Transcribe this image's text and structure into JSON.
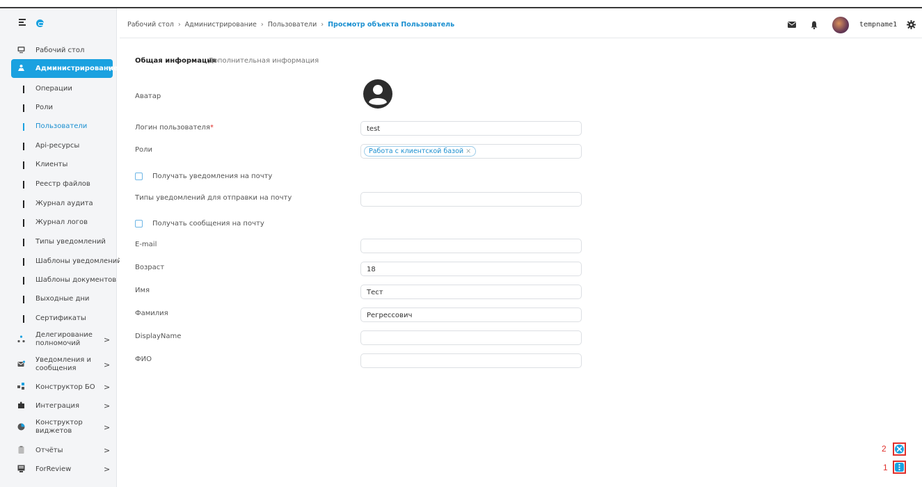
{
  "header": {
    "breadcrumbs": [
      "Рабочий стол",
      "Администрирование",
      "Пользователи"
    ],
    "breadcrumb_current": "Просмотр объекта Пользователь",
    "separator": "›",
    "username": "tempname1"
  },
  "sidebar": {
    "top_items": [
      {
        "label": "Рабочий стол",
        "icon": "monitor-icon"
      },
      {
        "label": "Администрирование",
        "icon": "admin-icon",
        "chevron": "∨"
      }
    ],
    "sub_items": [
      {
        "label": "Операции"
      },
      {
        "label": "Роли"
      },
      {
        "label": "Пользователи"
      },
      {
        "label": "Api-ресурсы"
      },
      {
        "label": "Клиенты"
      },
      {
        "label": "Реестр файлов"
      },
      {
        "label": "Журнал аудита"
      },
      {
        "label": "Журнал логов"
      },
      {
        "label": "Типы уведомлений"
      },
      {
        "label": "Шаблоны уведомлений"
      },
      {
        "label": "Шаблоны документов"
      },
      {
        "label": "Выходные дни"
      },
      {
        "label": "Сертификаты"
      }
    ],
    "bottom_items": [
      {
        "line1": "Делегирование",
        "line2": "полномочий",
        "icon": "delegation-icon",
        "chevron": ">"
      },
      {
        "line1": "Уведомления и",
        "line2": "сообщения",
        "icon": "notifications-icon",
        "chevron": ">"
      },
      {
        "line1": "Конструктор БО",
        "line2": "",
        "icon": "constructor-icon",
        "chevron": ">"
      },
      {
        "line1": "Интеграция",
        "line2": "",
        "icon": "puzzle-icon",
        "chevron": ">"
      },
      {
        "line1": "Конструктор",
        "line2": "виджетов",
        "icon": "widget-icon",
        "chevron": ">"
      },
      {
        "line1": "Отчёты",
        "line2": "",
        "icon": "clipboard-icon",
        "chevron": ">"
      },
      {
        "line1": "ForReview",
        "line2": "",
        "icon": "review-icon",
        "chevron": ">"
      }
    ],
    "accent_color": "#1aa1e0"
  },
  "tabs": {
    "active": "Общая информация",
    "inactive": "Дополнительная информация"
  },
  "form": {
    "avatar_label": "Аватар",
    "login_label": "Логин пользователя",
    "login_required_mark": "*",
    "login_value": "test",
    "roles_label": "Роли",
    "role_chip": "Работа с клиентской базой",
    "role_chip_remove": "×",
    "notify_email_label": "Получать уведомления на почту",
    "notify_types_label": "Типы уведомлений для отправки на почту",
    "notify_types_value": "",
    "messages_email_label": "Получать сообщения на почту",
    "email_label": "E-mail",
    "email_value": "",
    "age_label": "Возраст",
    "age_value": "18",
    "first_name_label": "Имя",
    "first_name_value": "Тест",
    "last_name_label": "Фамилия",
    "last_name_value": "Регрессович",
    "display_name_label": "DisplayName",
    "display_name_value": "",
    "fio_label": "ФИО",
    "fio_value": ""
  },
  "fab": {
    "close_number": "2",
    "menu_number": "1"
  }
}
